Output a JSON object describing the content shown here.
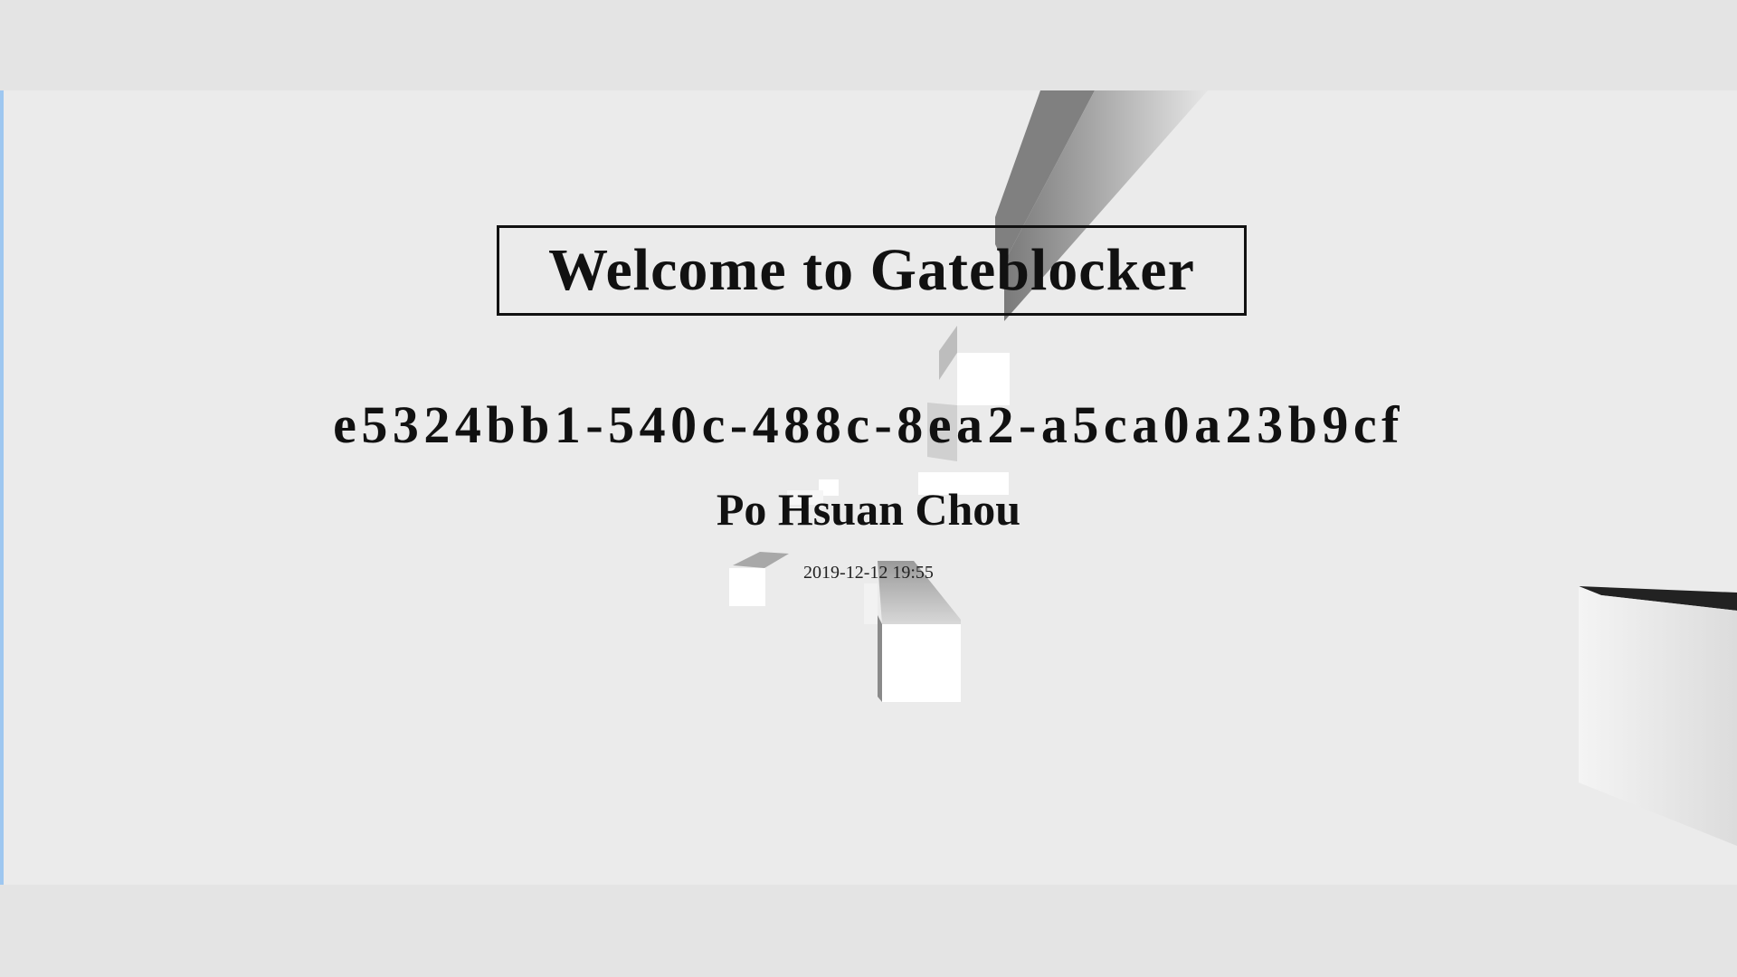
{
  "page": {
    "title": "Welcome to Gateblocker",
    "uuid": "e5324bb1-540c-488c-8ea2-a5ca0a23b9cf",
    "name": "Po Hsuan Chou",
    "timestamp": "2019-12-12 19:55"
  },
  "colors": {
    "background": "#ebebeb",
    "letterbox": "#e4e4e4",
    "edge_bar": "#9ec7f0",
    "text": "#111111"
  }
}
